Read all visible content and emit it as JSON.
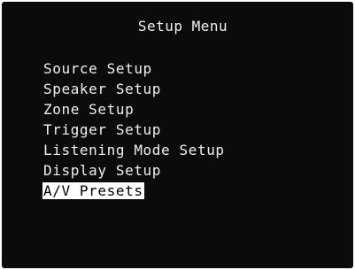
{
  "header": {
    "title": "Setup Menu"
  },
  "menu": {
    "items": [
      {
        "label": "Source Setup",
        "selected": false
      },
      {
        "label": "Speaker Setup",
        "selected": false
      },
      {
        "label": "Zone Setup",
        "selected": false
      },
      {
        "label": "Trigger Setup",
        "selected": false
      },
      {
        "label": "Listening Mode Setup",
        "selected": false
      },
      {
        "label": "Display Setup",
        "selected": false
      },
      {
        "label": "A/V Presets",
        "selected": true
      }
    ]
  },
  "colors": {
    "screen_background": "#0b0b0b",
    "text": "#f0f0f0",
    "highlight_background": "#ffffff",
    "highlight_text": "#000000"
  }
}
